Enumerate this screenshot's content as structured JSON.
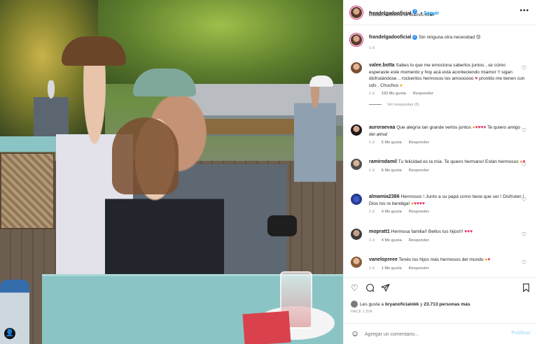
{
  "post_author": {
    "username": "frandelgadooficial",
    "follow_label": "Seguir",
    "location": "Ciudad Autónoma de Buenos Aires"
  },
  "caption": {
    "username": "frandelgadooficial",
    "text": "Sin ninguna otra necesidad",
    "emoji": "😍",
    "time": "1 d"
  },
  "comments": [
    {
      "username": "valee.botta",
      "text": "Sabes lo que me emociona saberlos juntos , se cómo esperaste este momento y hoy acá está aconteciendo miamor !! sigan disfrutándose .. rockeritos hermosos los amoooooo",
      "text_end": "prontito me tienen con uds . Chuchus",
      "time": "1 d",
      "likes": "193 Me gusta",
      "reply": "Responder",
      "view_replies": "Ver respuestas (5)"
    },
    {
      "username": "auroraevaa",
      "text": "Que alegría tan grande verlos juntos",
      "text_end": "Te quiero amigo del alma!",
      "time": "1 d",
      "likes": "5 Me gusta",
      "reply": "Responder"
    },
    {
      "username": "ramirodamil",
      "text": "Tu felicidad es la mía. Te quiero hermano! Están hermosos",
      "time": "1 d",
      "likes": "8 Me gusta",
      "reply": "Responder"
    },
    {
      "username": "almamia2386",
      "text": "Hermosos ! Junto a su papá como tiene que ser ! Disfruten ! Dios los re bendiga!",
      "time": "1 d",
      "likes": "4 Me gusta",
      "reply": "Responder"
    },
    {
      "username": "mopratt1",
      "text": "Hermosa familia!! Bellos tus hijos!!!",
      "time": "1 d",
      "likes": "4 Me gusta",
      "reply": "Responder"
    },
    {
      "username": "vanelopreee",
      "text": "Tenés los hijos más hermosos del mundo",
      "time": "1 d",
      "likes": "1 Me gusta",
      "reply": "Responder"
    }
  ],
  "likes_summary": {
    "prefix": "Les gusta a ",
    "user": "bryanoficialokk",
    "middle": " y ",
    "count": "23.713 personas más"
  },
  "time_ago": "HACE 1 DÍA",
  "add_comment": {
    "placeholder": "Agregar un comentario...",
    "post_label": "Publicar"
  },
  "colors": {
    "link": "#0095f6",
    "muted": "#8e8e8e",
    "text": "#262626",
    "heart": "#e0245e"
  },
  "icons": [
    "more-options-icon",
    "heart-icon",
    "comment-icon",
    "share-icon",
    "bookmark-icon",
    "emoji-icon",
    "verified-icon",
    "user-tag-icon"
  ]
}
